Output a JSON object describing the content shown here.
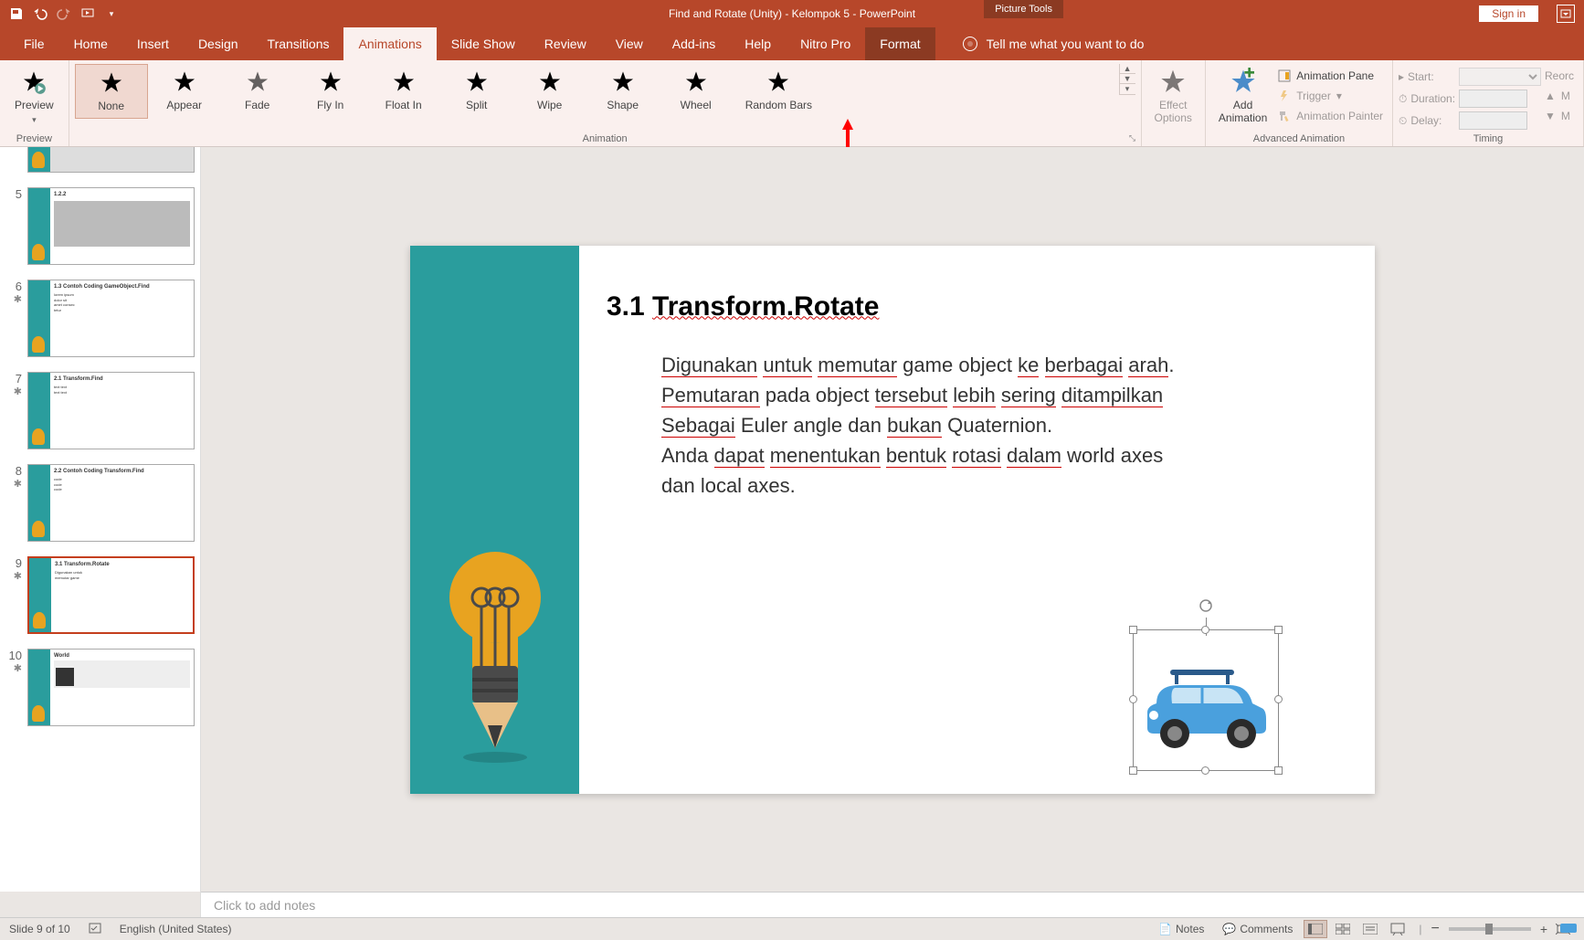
{
  "title": "Find and Rotate (Unity) - Kelompok 5  -  PowerPoint",
  "picture_tools": "Picture Tools",
  "signin": "Sign in",
  "tabs": {
    "file": "File",
    "home": "Home",
    "insert": "Insert",
    "design": "Design",
    "transitions": "Transitions",
    "animations": "Animations",
    "slideshow": "Slide Show",
    "review": "Review",
    "view": "View",
    "addins": "Add-ins",
    "help": "Help",
    "nitro": "Nitro Pro",
    "format": "Format"
  },
  "tellme": "Tell me what you want to do",
  "ribbon": {
    "preview": "Preview",
    "preview_group": "Preview",
    "animations": {
      "none": "None",
      "appear": "Appear",
      "fade": "Fade",
      "flyin": "Fly In",
      "floatin": "Float In",
      "split": "Split",
      "wipe": "Wipe",
      "shape": "Shape",
      "wheel": "Wheel",
      "randombars": "Random Bars"
    },
    "animation_group": "Animation",
    "effect_options": "Effect\nOptions",
    "add_animation": "Add\nAnimation",
    "advanced": {
      "pane": "Animation Pane",
      "trigger": "Trigger",
      "painter": "Animation Painter",
      "group": "Advanced Animation"
    },
    "timing": {
      "start": "Start:",
      "duration": "Duration:",
      "delay": "Delay:",
      "reorder": "Reorc",
      "move_earlier": "M",
      "move_later": "M",
      "group": "Timing"
    }
  },
  "thumbs": [
    {
      "num": "5",
      "title": "1.2.2",
      "anim": false
    },
    {
      "num": "6",
      "title": "1.3 Contoh Coding GameObject.Find",
      "anim": true
    },
    {
      "num": "7",
      "title": "2.1 Transform.Find",
      "anim": true
    },
    {
      "num": "8",
      "title": "2.2 Contoh Coding Transform.Find",
      "anim": true
    },
    {
      "num": "9",
      "title": "3.1 Transform.Rotate",
      "anim": true
    },
    {
      "num": "10",
      "title": "World",
      "anim": false
    }
  ],
  "slide": {
    "title_prefix": "3.1 ",
    "title_underline": "Transform.Rotate",
    "body_line1_parts": [
      "Digunakan",
      " ",
      "untuk",
      " ",
      "memutar",
      " game object ",
      "ke",
      " ",
      "berbagai",
      " ",
      "arah",
      "."
    ],
    "body_line2_parts": [
      "Pemutaran",
      " pada object ",
      "tersebut",
      " ",
      "lebih",
      " ",
      "sering",
      " ",
      "ditampilkan"
    ],
    "body_line3_parts": [
      "Sebagai",
      " Euler angle dan ",
      "bukan",
      " Quaternion."
    ],
    "body_line4": "",
    "body_line5_parts": [
      "Anda ",
      "dapat",
      " ",
      "menentukan",
      " ",
      "bentuk",
      " ",
      "rotasi",
      " ",
      "dalam",
      " world axes"
    ],
    "body_line6": "dan local axes."
  },
  "notes_placeholder": "Click to add notes",
  "status": {
    "slide": "Slide 9 of 10",
    "lang": "English (United States)",
    "notes": "Notes",
    "comments": "Comments"
  }
}
